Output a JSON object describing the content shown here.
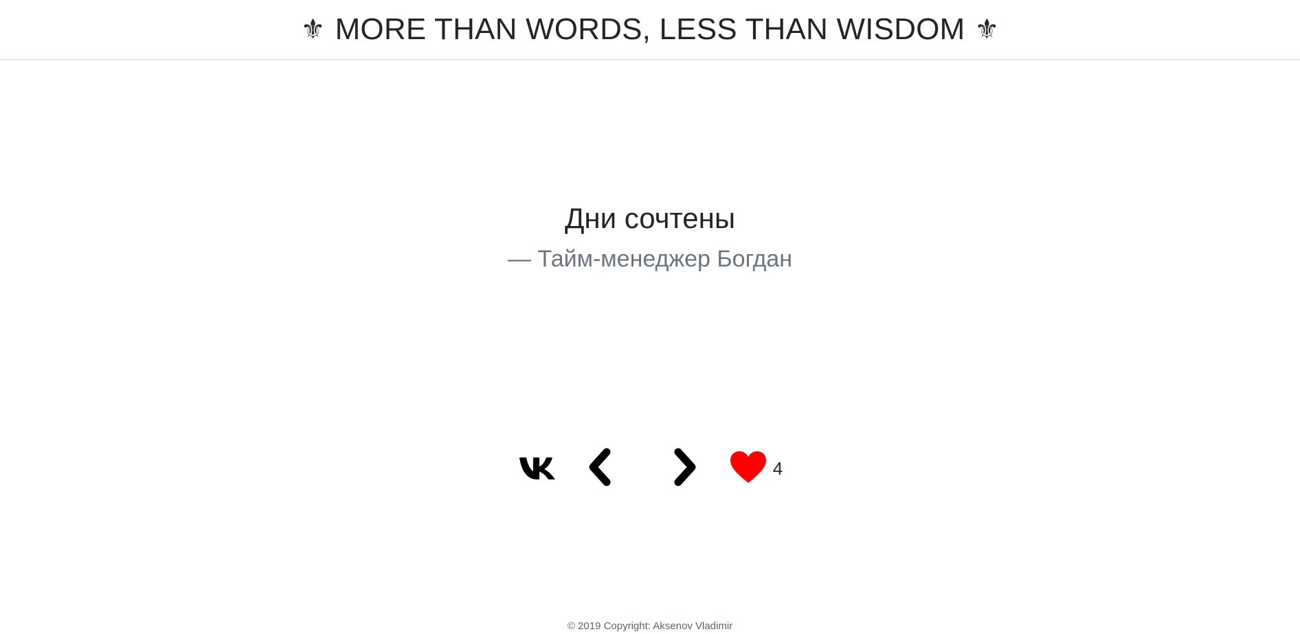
{
  "header": {
    "title": "MORE THAN WORDS, LESS THAN WISDOM",
    "ornament_left": "⚜",
    "ornament_right": "⚜"
  },
  "quote": {
    "text": "Дни сочтены",
    "author": "— Тайм-менеджер Богдан"
  },
  "actions": {
    "share_icon": "vk-icon",
    "prev_icon": "chevron-left-icon",
    "next_icon": "chevron-right-icon",
    "like_icon": "heart-icon",
    "like_color": "#ff0000",
    "like_count": "4"
  },
  "footer": {
    "copyright": "© 2019 Copyright: Aksenov Vladimir"
  }
}
